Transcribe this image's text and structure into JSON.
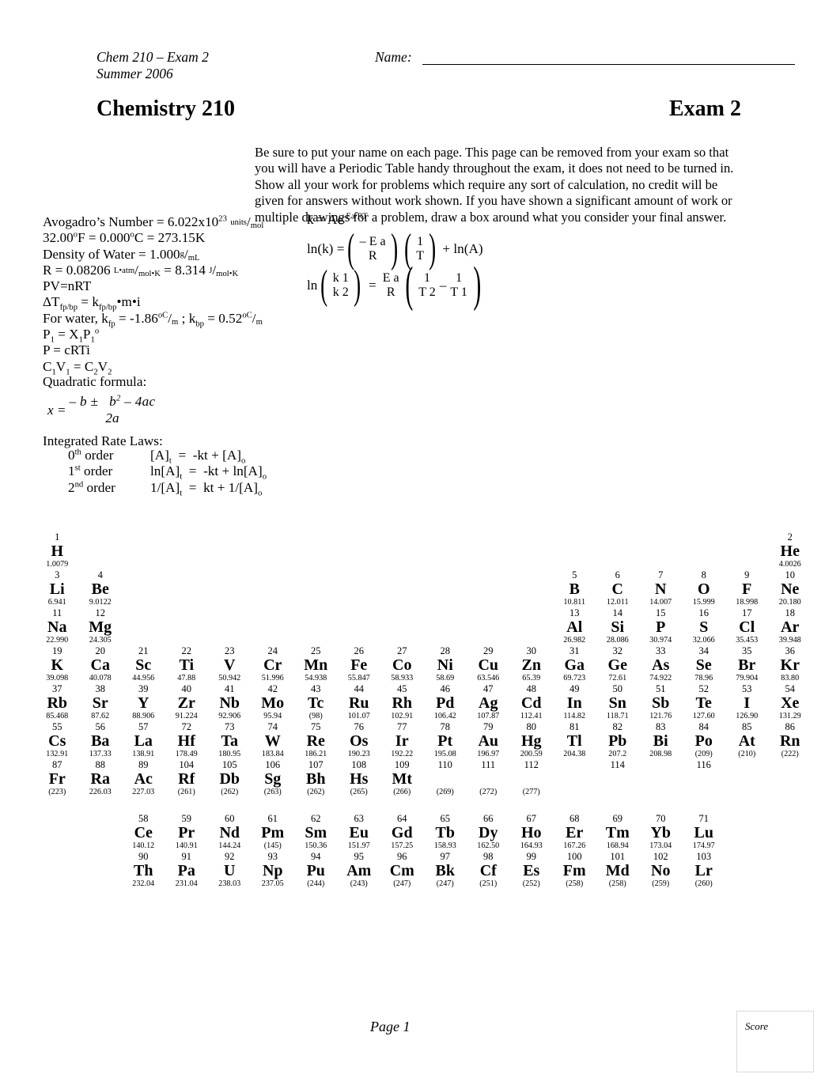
{
  "header": {
    "course_line1": "Chem 210 – Exam 2",
    "course_line2": "Summer 2006",
    "name_label": "Name:",
    "title_left": "Chemistry 210",
    "title_right": "Exam 2"
  },
  "instructions": {
    "text": "Be sure to put your name on each page.  This page can be removed from your exam so that you will have a Periodic Table handy throughout the exam, it does not need to be turned in.  Show all your work for problems which require any sort of calculation, no credit will be given for answers without work shown.  If you have shown a significant amount of work or multiple drawings for a problem, draw a box around what you consider your final answer."
  },
  "constants": {
    "avogadro_label": "Avogadro’s Number = 6.022x10",
    "avogadro_exp": "23",
    "avogadro_unit_num": "units",
    "avogadro_unit_den": "mol",
    "temp_line": "32.00oF = 0.000oC = 273.15K",
    "density_label": "Density of Water = 1.000",
    "density_num": "g",
    "density_den": "mL",
    "r_label": "R = 0.08206",
    "r_num1": "L•atm",
    "r_den1": "mol•K",
    "r_mid": "= 8.314",
    "r_num2": "J",
    "r_den2": "mol•K",
    "pvnrt": "PV=nRT",
    "delta_t": "ΔTfp/bp = kfp/bp•m•i",
    "for_water": "For water, kfp = -1.86oC/m ; kbp = 0.52oC/m",
    "raoult": "P1 = X1P1o",
    "osmotic": "P = cRTi",
    "dilution": "C1V1 = C2V2"
  },
  "arrhenius": {
    "k_eq": "k = Ae",
    "k_exp": "-Ea/RT",
    "lnk_lhs": "ln(k) =",
    "lnk_num": "– E a",
    "lnk_den": "R",
    "lnk_num2": "1",
    "lnk_den2": "T",
    "lnk_tail": "+ ln(A)",
    "two_pt_lhs": "ln",
    "two_pt_k1": "k 1",
    "two_pt_k2": "k 2",
    "two_pt_eq": "=",
    "two_pt_ea": "E a",
    "two_pt_r": "R",
    "two_pt_one_a": "1",
    "two_pt_t2": "T 2",
    "two_pt_minus": "–",
    "two_pt_one_b": "1",
    "two_pt_t1": "T 1"
  },
  "quadratic": {
    "label": "Quadratic formula:",
    "x_eq": "x =",
    "numerator": "– b ±   b 2 – 4ac",
    "denominator": "2a"
  },
  "rate_laws": {
    "title": "Integrated Rate Laws:",
    "rows": [
      {
        "order": "0th order",
        "order_base": "0",
        "order_sup": "th",
        "equation": "[A]t  =  -kt + [A]o"
      },
      {
        "order": "1st order",
        "order_base": "1",
        "order_sup": "st",
        "equation": "ln[A]t  =  -kt + ln[A]o"
      },
      {
        "order": "2nd order",
        "order_base": "2",
        "order_sup": "nd",
        "equation": "1/[A]t  =  kt + 1/[A]o"
      }
    ]
  },
  "periodic_table": {
    "main_rows": [
      [
        {
          "num": "1",
          "sym": "H",
          "mass": "1.0079"
        },
        {
          "empty": true
        },
        {
          "empty": true
        },
        {
          "empty": true
        },
        {
          "empty": true
        },
        {
          "empty": true
        },
        {
          "empty": true
        },
        {
          "empty": true
        },
        {
          "empty": true
        },
        {
          "empty": true
        },
        {
          "empty": true
        },
        {
          "empty": true
        },
        {
          "empty": true
        },
        {
          "empty": true
        },
        {
          "empty": true
        },
        {
          "empty": true
        },
        {
          "empty": true
        },
        {
          "num": "2",
          "sym": "He",
          "mass": "4.0026"
        }
      ],
      [
        {
          "num": "3",
          "sym": "Li",
          "mass": "6.941"
        },
        {
          "num": "4",
          "sym": "Be",
          "mass": "9.0122"
        },
        {
          "empty": true
        },
        {
          "empty": true
        },
        {
          "empty": true
        },
        {
          "empty": true
        },
        {
          "empty": true
        },
        {
          "empty": true
        },
        {
          "empty": true
        },
        {
          "empty": true
        },
        {
          "empty": true
        },
        {
          "empty": true
        },
        {
          "num": "5",
          "sym": "B",
          "mass": "10.811"
        },
        {
          "num": "6",
          "sym": "C",
          "mass": "12.011"
        },
        {
          "num": "7",
          "sym": "N",
          "mass": "14.007"
        },
        {
          "num": "8",
          "sym": "O",
          "mass": "15.999"
        },
        {
          "num": "9",
          "sym": "F",
          "mass": "18.998"
        },
        {
          "num": "10",
          "sym": "Ne",
          "mass": "20.180"
        }
      ],
      [
        {
          "num": "11",
          "sym": "Na",
          "mass": "22.990"
        },
        {
          "num": "12",
          "sym": "Mg",
          "mass": "24.305"
        },
        {
          "empty": true
        },
        {
          "empty": true
        },
        {
          "empty": true
        },
        {
          "empty": true
        },
        {
          "empty": true
        },
        {
          "empty": true
        },
        {
          "empty": true
        },
        {
          "empty": true
        },
        {
          "empty": true
        },
        {
          "empty": true
        },
        {
          "num": "13",
          "sym": "Al",
          "mass": "26.982"
        },
        {
          "num": "14",
          "sym": "Si",
          "mass": "28.086"
        },
        {
          "num": "15",
          "sym": "P",
          "mass": "30.974"
        },
        {
          "num": "16",
          "sym": "S",
          "mass": "32.066"
        },
        {
          "num": "17",
          "sym": "Cl",
          "mass": "35.453"
        },
        {
          "num": "18",
          "sym": "Ar",
          "mass": "39.948"
        }
      ],
      [
        {
          "num": "19",
          "sym": "K",
          "mass": "39.098"
        },
        {
          "num": "20",
          "sym": "Ca",
          "mass": "40.078"
        },
        {
          "num": "21",
          "sym": "Sc",
          "mass": "44.956"
        },
        {
          "num": "22",
          "sym": "Ti",
          "mass": "47.88"
        },
        {
          "num": "23",
          "sym": "V",
          "mass": "50.942"
        },
        {
          "num": "24",
          "sym": "Cr",
          "mass": "51.996"
        },
        {
          "num": "25",
          "sym": "Mn",
          "mass": "54.938"
        },
        {
          "num": "26",
          "sym": "Fe",
          "mass": "55.847"
        },
        {
          "num": "27",
          "sym": "Co",
          "mass": "58.933"
        },
        {
          "num": "28",
          "sym": "Ni",
          "mass": "58.69"
        },
        {
          "num": "29",
          "sym": "Cu",
          "mass": "63.546"
        },
        {
          "num": "30",
          "sym": "Zn",
          "mass": "65.39"
        },
        {
          "num": "31",
          "sym": "Ga",
          "mass": "69.723"
        },
        {
          "num": "32",
          "sym": "Ge",
          "mass": "72.61"
        },
        {
          "num": "33",
          "sym": "As",
          "mass": "74.922"
        },
        {
          "num": "34",
          "sym": "Se",
          "mass": "78.96"
        },
        {
          "num": "35",
          "sym": "Br",
          "mass": "79.904"
        },
        {
          "num": "36",
          "sym": "Kr",
          "mass": "83.80"
        }
      ],
      [
        {
          "num": "37",
          "sym": "Rb",
          "mass": "85.468"
        },
        {
          "num": "38",
          "sym": "Sr",
          "mass": "87.62"
        },
        {
          "num": "39",
          "sym": "Y",
          "mass": "88.906"
        },
        {
          "num": "40",
          "sym": "Zr",
          "mass": "91.224"
        },
        {
          "num": "41",
          "sym": "Nb",
          "mass": "92.906"
        },
        {
          "num": "42",
          "sym": "Mo",
          "mass": "95.94"
        },
        {
          "num": "43",
          "sym": "Tc",
          "mass": "(98)"
        },
        {
          "num": "44",
          "sym": "Ru",
          "mass": "101.07"
        },
        {
          "num": "45",
          "sym": "Rh",
          "mass": "102.91"
        },
        {
          "num": "46",
          "sym": "Pd",
          "mass": "106.42"
        },
        {
          "num": "47",
          "sym": "Ag",
          "mass": "107.87"
        },
        {
          "num": "48",
          "sym": "Cd",
          "mass": "112.41"
        },
        {
          "num": "49",
          "sym": "In",
          "mass": "114.82"
        },
        {
          "num": "50",
          "sym": "Sn",
          "mass": "118.71"
        },
        {
          "num": "51",
          "sym": "Sb",
          "mass": "121.76"
        },
        {
          "num": "52",
          "sym": "Te",
          "mass": "127.60"
        },
        {
          "num": "53",
          "sym": "I",
          "mass": "126.90"
        },
        {
          "num": "54",
          "sym": "Xe",
          "mass": "131.29"
        }
      ],
      [
        {
          "num": "55",
          "sym": "Cs",
          "mass": "132.91"
        },
        {
          "num": "56",
          "sym": "Ba",
          "mass": "137.33"
        },
        {
          "num": "57",
          "sym": "La",
          "mass": "138.91"
        },
        {
          "num": "72",
          "sym": "Hf",
          "mass": "178.49"
        },
        {
          "num": "73",
          "sym": "Ta",
          "mass": "180.95"
        },
        {
          "num": "74",
          "sym": "W",
          "mass": "183.84"
        },
        {
          "num": "75",
          "sym": "Re",
          "mass": "186.21"
        },
        {
          "num": "76",
          "sym": "Os",
          "mass": "190.23"
        },
        {
          "num": "77",
          "sym": "Ir",
          "mass": "192.22"
        },
        {
          "num": "78",
          "sym": "Pt",
          "mass": "195.08"
        },
        {
          "num": "79",
          "sym": "Au",
          "mass": "196.97"
        },
        {
          "num": "80",
          "sym": "Hg",
          "mass": "200.59"
        },
        {
          "num": "81",
          "sym": "Tl",
          "mass": "204.38"
        },
        {
          "num": "82",
          "sym": "Pb",
          "mass": "207.2"
        },
        {
          "num": "83",
          "sym": "Bi",
          "mass": "208.98"
        },
        {
          "num": "84",
          "sym": "Po",
          "mass": "(209)"
        },
        {
          "num": "85",
          "sym": "At",
          "mass": "(210)"
        },
        {
          "num": "86",
          "sym": "Rn",
          "mass": "(222)"
        }
      ],
      [
        {
          "num": "87",
          "sym": "Fr",
          "mass": "(223)"
        },
        {
          "num": "88",
          "sym": "Ra",
          "mass": "226.03"
        },
        {
          "num": "89",
          "sym": "Ac",
          "mass": "227.03"
        },
        {
          "num": "104",
          "sym": "Rf",
          "mass": "(261)"
        },
        {
          "num": "105",
          "sym": "Db",
          "mass": "(262)"
        },
        {
          "num": "106",
          "sym": "Sg",
          "mass": "(263)"
        },
        {
          "num": "107",
          "sym": "Bh",
          "mass": "(262)"
        },
        {
          "num": "108",
          "sym": "Hs",
          "mass": "(265)"
        },
        {
          "num": "109",
          "sym": "Mt",
          "mass": "(266)"
        },
        {
          "num": "110",
          "sym": "",
          "mass": "(269)",
          "nosym": true
        },
        {
          "num": "111",
          "sym": "",
          "mass": "(272)",
          "nosym": true
        },
        {
          "num": "112",
          "sym": "",
          "mass": "(277)",
          "nosym": true
        },
        {
          "empty": true
        },
        {
          "num": "114",
          "sym": "",
          "mass": "",
          "nosym": true,
          "nomass": true
        },
        {
          "empty": true
        },
        {
          "num": "116",
          "sym": "",
          "mass": "",
          "nosym": true,
          "nomass": true
        },
        {
          "empty": true
        },
        {
          "empty": true
        }
      ]
    ],
    "f_block_rows": [
      [
        {
          "num": "58",
          "sym": "Ce",
          "mass": "140.12"
        },
        {
          "num": "59",
          "sym": "Pr",
          "mass": "140.91"
        },
        {
          "num": "60",
          "sym": "Nd",
          "mass": "144.24"
        },
        {
          "num": "61",
          "sym": "Pm",
          "mass": "(145)"
        },
        {
          "num": "62",
          "sym": "Sm",
          "mass": "150.36"
        },
        {
          "num": "63",
          "sym": "Eu",
          "mass": "151.97"
        },
        {
          "num": "64",
          "sym": "Gd",
          "mass": "157.25"
        },
        {
          "num": "65",
          "sym": "Tb",
          "mass": "158.93"
        },
        {
          "num": "66",
          "sym": "Dy",
          "mass": "162.50"
        },
        {
          "num": "67",
          "sym": "Ho",
          "mass": "164.93"
        },
        {
          "num": "68",
          "sym": "Er",
          "mass": "167.26"
        },
        {
          "num": "69",
          "sym": "Tm",
          "mass": "168.94"
        },
        {
          "num": "70",
          "sym": "Yb",
          "mass": "173.04"
        },
        {
          "num": "71",
          "sym": "Lu",
          "mass": "174.97"
        }
      ],
      [
        {
          "num": "90",
          "sym": "Th",
          "mass": "232.04"
        },
        {
          "num": "91",
          "sym": "Pa",
          "mass": "231.04"
        },
        {
          "num": "92",
          "sym": "U",
          "mass": "238.03"
        },
        {
          "num": "93",
          "sym": "Np",
          "mass": "237.05"
        },
        {
          "num": "94",
          "sym": "Pu",
          "mass": "(244)"
        },
        {
          "num": "95",
          "sym": "Am",
          "mass": "(243)"
        },
        {
          "num": "96",
          "sym": "Cm",
          "mass": "(247)"
        },
        {
          "num": "97",
          "sym": "Bk",
          "mass": "(247)"
        },
        {
          "num": "98",
          "sym": "Cf",
          "mass": "(251)"
        },
        {
          "num": "99",
          "sym": "Es",
          "mass": "(252)"
        },
        {
          "num": "100",
          "sym": "Fm",
          "mass": "(258)"
        },
        {
          "num": "101",
          "sym": "Md",
          "mass": "(258)"
        },
        {
          "num": "102",
          "sym": "No",
          "mass": "(259)"
        },
        {
          "num": "103",
          "sym": "Lr",
          "mass": "(260)"
        }
      ]
    ]
  },
  "footer": {
    "page_label": "Page 1",
    "score_label": "Score"
  }
}
